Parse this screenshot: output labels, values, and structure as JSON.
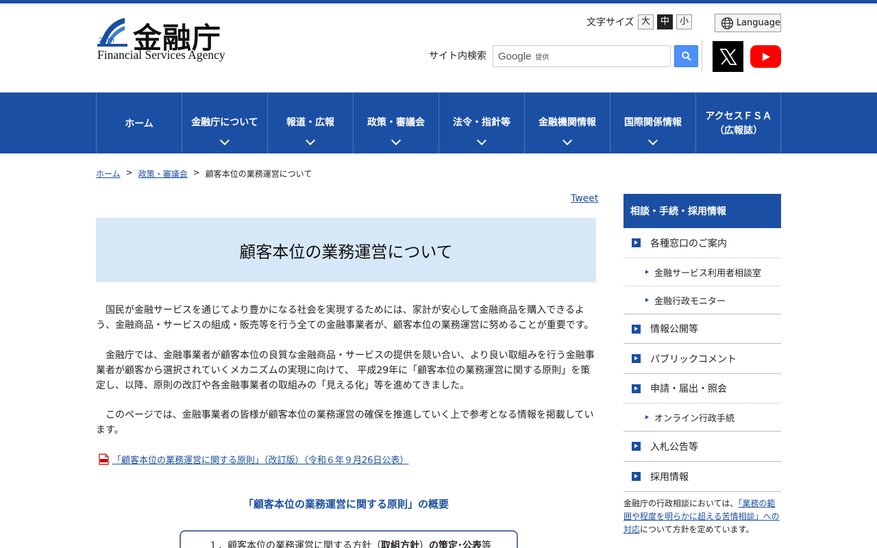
{
  "header": {
    "logo_jp": "金融庁",
    "logo_en": "Financial Services Agency",
    "fontsize_label": "文字サイズ",
    "fontsize_options": [
      "大",
      "中",
      "小"
    ],
    "language_label": "Language",
    "search_label": "サイト内検索",
    "search_brand": "Google",
    "search_provided": "提供"
  },
  "nav": {
    "items": [
      "ホーム",
      "金融庁について",
      "報道・広報",
      "政策・審議会",
      "法令・指針等",
      "金融機関情報",
      "国際関係情報"
    ],
    "access_line1": "アクセスＦＳＡ",
    "access_line2": "（広報誌）"
  },
  "breadcrumb": {
    "home": "ホーム",
    "sep": ">",
    "policy": "政策・審議会",
    "current": "顧客本位の業務運営について"
  },
  "main": {
    "tweet": "Tweet",
    "title": "顧客本位の業務運営について",
    "para1": "国民が金融サービスを通じてより豊かになる社会を実現するためには、家計が安心して金融商品を購入できるよう、金融商品・サービスの組成・販売等を行う全ての金融事業者が、顧客本位の業務運営に努めることが重要です。",
    "para2": "金融庁では、金融事業者が顧客本位の良質な金融商品・サービスの提供を競い合い、より良い取組みを行う金融事業者が顧客から選択されていくメカニズムの実現に向けて、 平成29年に「顧客本位の業務運営に関する原則」を策定し、以降、原則の改訂や各金融事業者の取組みの「見える化」等を進めてきました。",
    "para3": "このページでは、金融事業者の皆様が顧客本位の業務運営の確保を推進していく上で参考となる情報を掲載しています。",
    "pdf_link": "「顧客本位の業務運営に関する原則」（改訂版）（令和６年９月26日公表）",
    "section_title": "「顧客本位の業務運営に関する原則」の概要",
    "outline_item_prefix": "１．顧客本位の業務運営に関する方針（",
    "outline_item_bold1": "取組方針",
    "outline_item_mid": "）",
    "outline_item_bold2": "の策定･公表",
    "outline_item_suffix": "等"
  },
  "sidebar": {
    "heading": "相談・手続・採用情報",
    "item_contact": "各種窓口のご案内",
    "sub_consult": "金融サービス利用者相談室",
    "sub_monitor": "金融行政モニター",
    "item_disclosure": "情報公開等",
    "item_public_comment": "パブリックコメント",
    "item_application": "申請・届出・照会",
    "sub_online": "オンライン行政手続",
    "item_bidding": "入札公告等",
    "item_recruit": "採用情報",
    "note_before": "金融庁の行政相談においては、",
    "note_link": "「業務の範囲や程度を明らかに超える苦情相談」への対応",
    "note_after": "について方針を定めています。"
  },
  "colors": {
    "brand_blue": "#1b4fa3",
    "title_bg": "#d6e8f7",
    "search_button": "#4d90fe",
    "youtube_red": "#ff0000"
  }
}
